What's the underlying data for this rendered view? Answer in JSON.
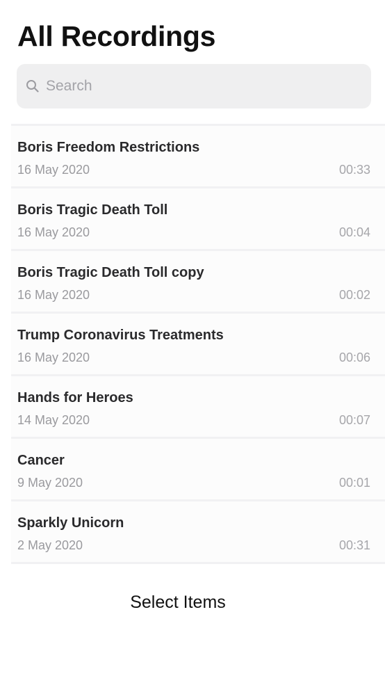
{
  "header": {
    "title": "All Recordings"
  },
  "search": {
    "icon": "search-icon",
    "placeholder": "Search"
  },
  "recordings": [
    {
      "title": "Boris Freedom Restrictions",
      "date": "16 May 2020",
      "duration": "00:33"
    },
    {
      "title": "Boris Tragic Death Toll",
      "date": "16 May 2020",
      "duration": "00:04"
    },
    {
      "title": "Boris Tragic Death Toll copy",
      "date": "16 May 2020",
      "duration": "00:02"
    },
    {
      "title": "Trump Coronavirus Treatments",
      "date": "16 May 2020",
      "duration": "00:06"
    },
    {
      "title": "Hands for Heroes",
      "date": "14 May 2020",
      "duration": "00:07"
    },
    {
      "title": "Cancer",
      "date": "9 May 2020",
      "duration": "00:01"
    },
    {
      "title": "Sparkly Unicorn",
      "date": "2 May 2020",
      "duration": "00:31"
    }
  ],
  "footer": {
    "select_label": "Select Items"
  }
}
